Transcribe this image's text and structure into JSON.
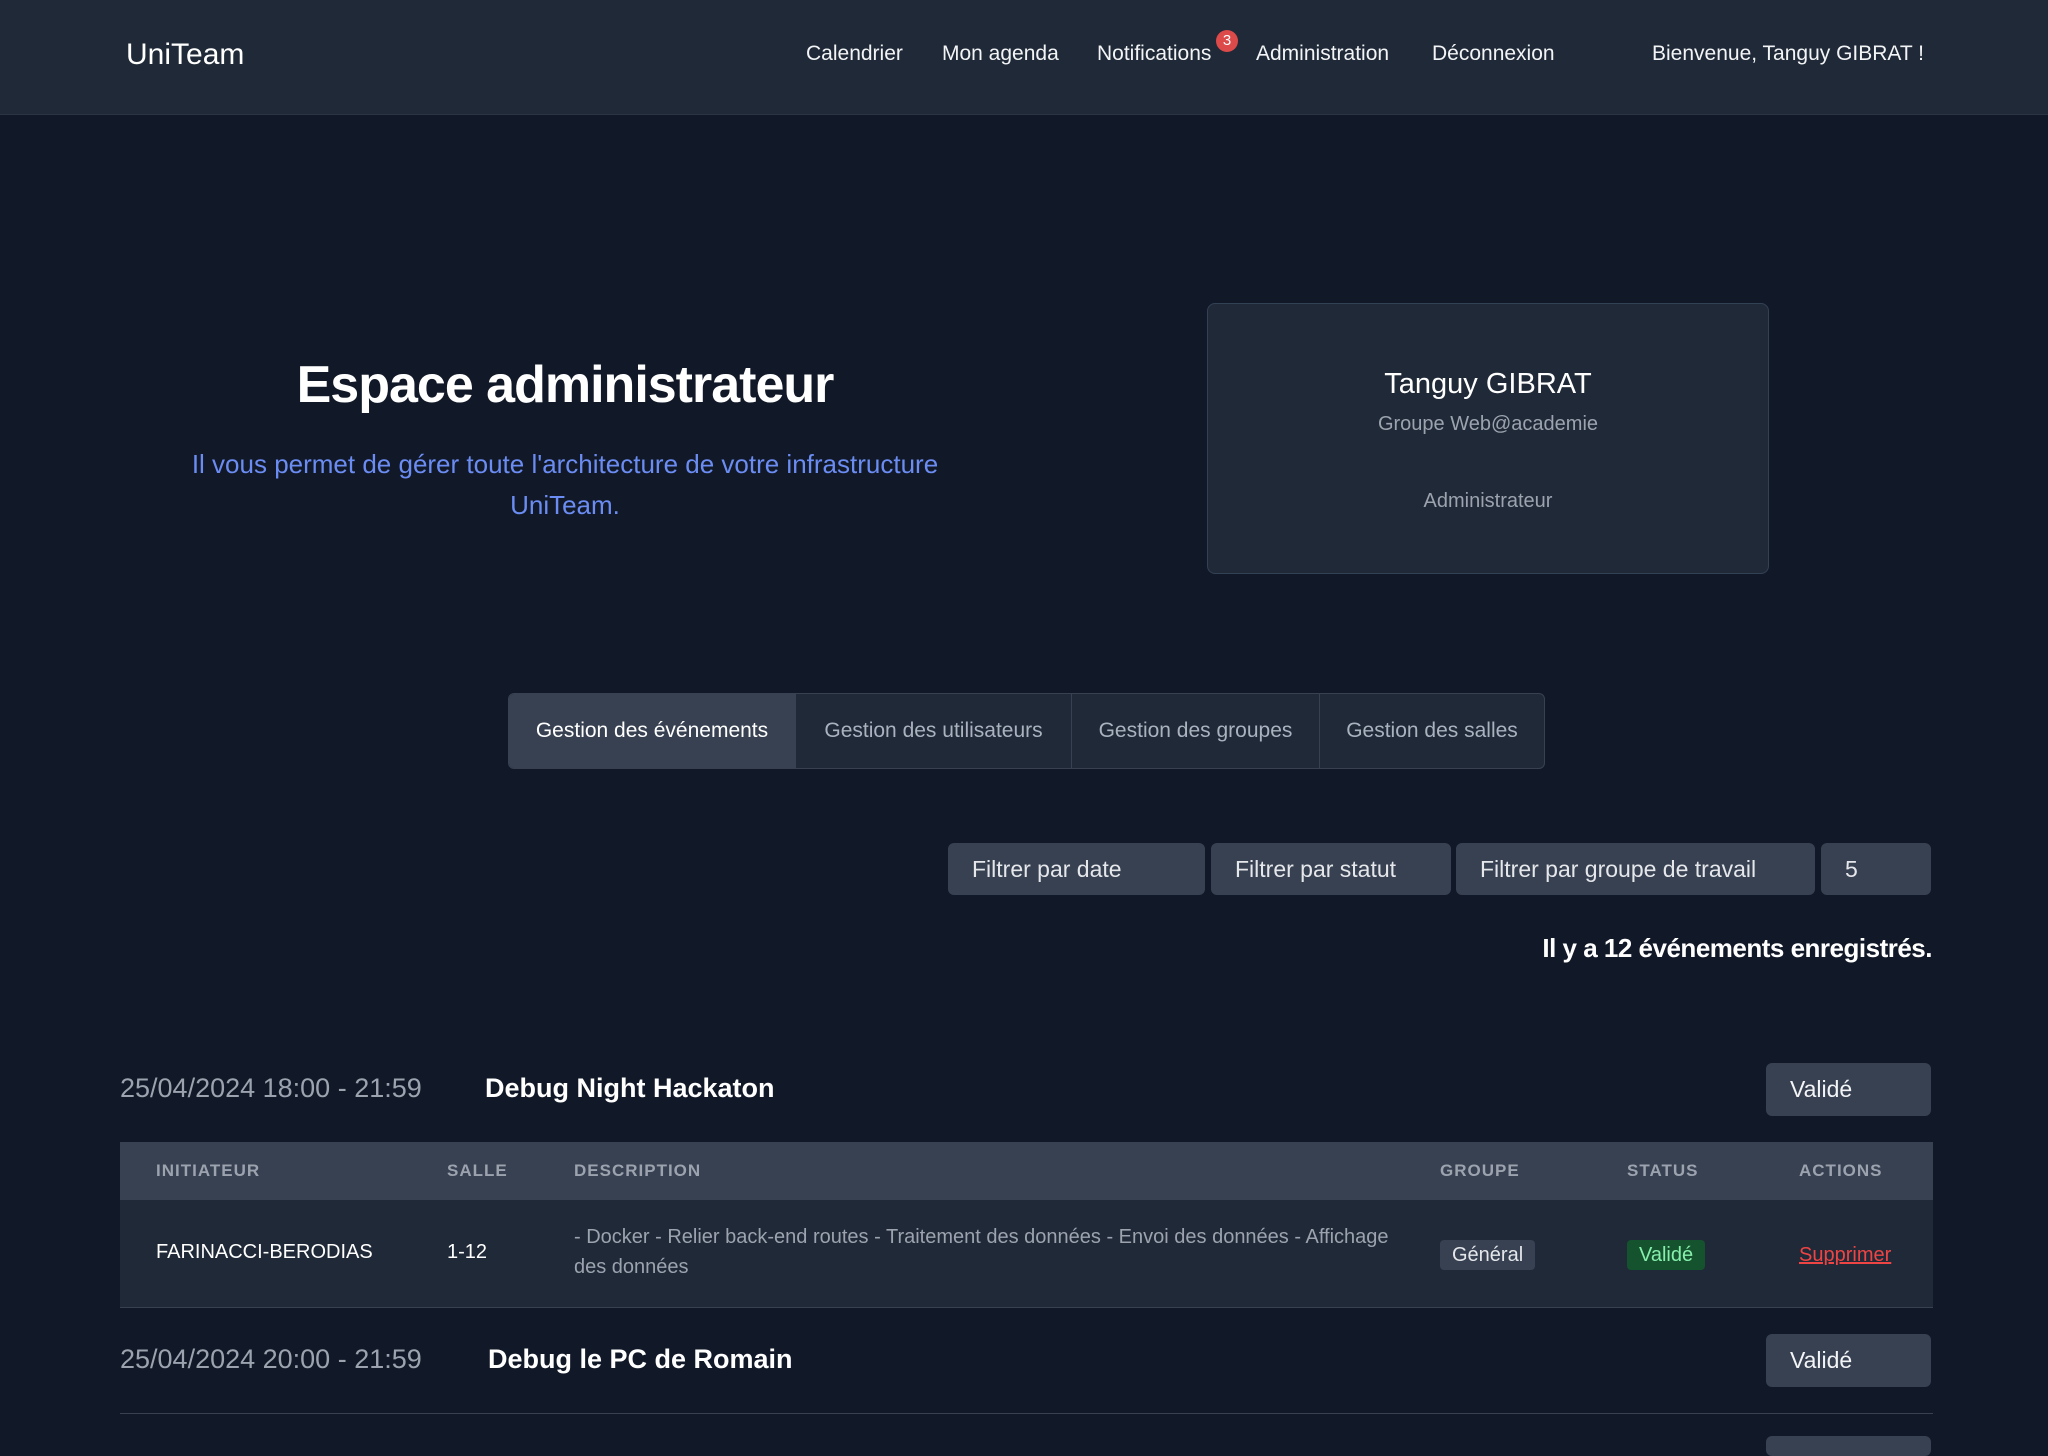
{
  "nav": {
    "brand": "UniTeam",
    "links": [
      "Calendrier",
      "Mon agenda",
      "Notifications",
      "Administration",
      "Déconnexion"
    ],
    "notification_count": "3",
    "welcome": "Bienvenue, Tanguy GIBRAT !"
  },
  "hero": {
    "title": "Espace administrateur",
    "subtitle_line1": "Il vous permet de gérer toute l'architecture de votre infrastructure",
    "subtitle_line2": "UniTeam."
  },
  "profile": {
    "name": "Tanguy GIBRAT",
    "group": "Groupe Web@academie",
    "role": "Administrateur"
  },
  "tabs": [
    {
      "label": "Gestion des événements",
      "active": true
    },
    {
      "label": "Gestion des utilisateurs",
      "active": false
    },
    {
      "label": "Gestion des groupes",
      "active": false
    },
    {
      "label": "Gestion des salles",
      "active": false
    }
  ],
  "filters": {
    "date": "Filtrer par date",
    "status": "Filtrer par statut",
    "group": "Filtrer par groupe de travail",
    "limit": "5"
  },
  "events_count_text": "Il y a 12 événements enregistrés.",
  "events": [
    {
      "datetime": "25/04/2024 18:00 - 21:59",
      "title": "Debug Night Hackaton",
      "status_button": "Validé",
      "table": {
        "headers": [
          "INITIATEUR",
          "SALLE",
          "DESCRIPTION",
          "GROUPE",
          "STATUS",
          "ACTIONS"
        ],
        "row": {
          "initiator": "FARINACCI-BERODIAS",
          "room": "1-12",
          "description": "- Docker - Relier back-end routes - Traitement des données - Envoi des données - Affichage des données",
          "group": "Général",
          "status": "Validé",
          "action": "Supprimer"
        }
      }
    },
    {
      "datetime": "25/04/2024 20:00 - 21:59",
      "title": "Debug le PC de Romain",
      "status_button": "Validé"
    }
  ],
  "colors": {
    "background": "#111827",
    "navbar": "#1f2937",
    "accent_blue": "#6b8cf2",
    "badge_red": "#dc4a4a",
    "status_green": "#86efac",
    "delete_red": "#ef4444"
  }
}
